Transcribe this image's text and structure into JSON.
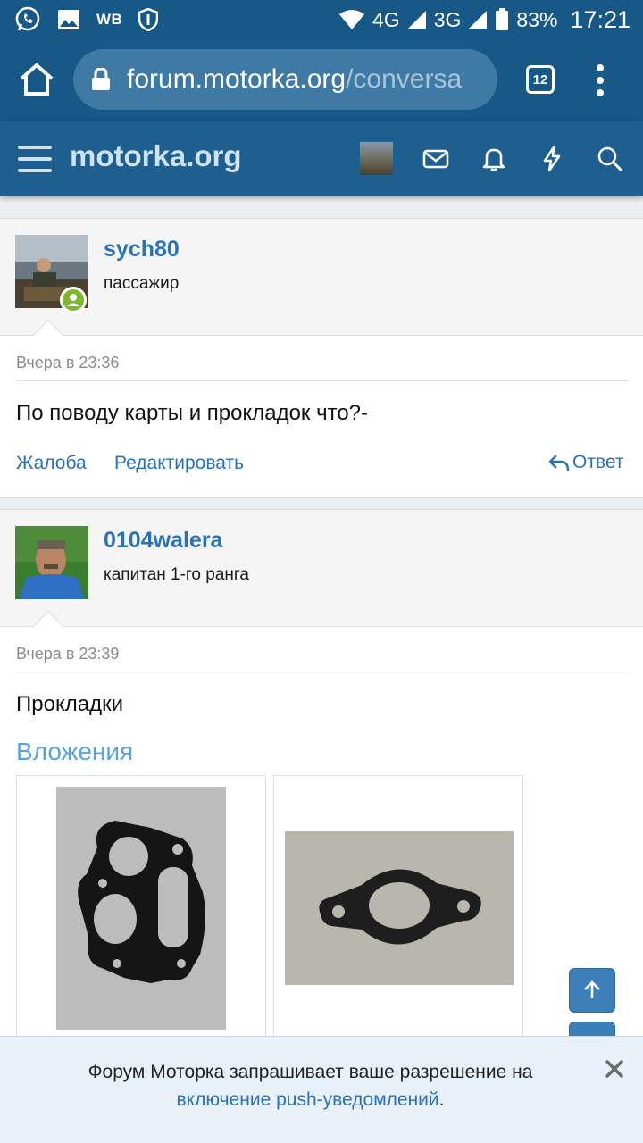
{
  "status_bar": {
    "carrier_badge": "WB",
    "network_1": "4G",
    "network_2": "3G",
    "battery": "83%",
    "time": "17:21"
  },
  "browser": {
    "url_host": "forum.motorka.org",
    "url_path": "/conversa",
    "tab_count": "12"
  },
  "forum_header": {
    "site_title": "motorka.org",
    "icons": [
      "menu-icon",
      "mail-icon",
      "bell-icon",
      "lightning-icon",
      "search-icon"
    ]
  },
  "posts": [
    {
      "username": "sych80",
      "user_title": "пассажир",
      "online": true,
      "date": "Вчера в 23:36",
      "text": "По поводу карты и прокладок что?-",
      "actions": {
        "report": "Жалоба",
        "edit": "Редактировать",
        "reply": "Ответ"
      }
    },
    {
      "username": "0104walera",
      "user_title": "капитан 1-го ранга",
      "online": false,
      "date": "Вчера в 23:39",
      "text": "Прокладки",
      "attachments_title": "Вложения"
    }
  ],
  "push_notice": {
    "text_before": "Форум Моторка запрашивает ваше разрешение на",
    "link_text": "включение push-уведомлений",
    "text_after": "."
  },
  "colors": {
    "header_bg": "#185886",
    "forum_bar": "#1f5f8f",
    "link": "#2a72b5",
    "online": "#7cb82f"
  }
}
